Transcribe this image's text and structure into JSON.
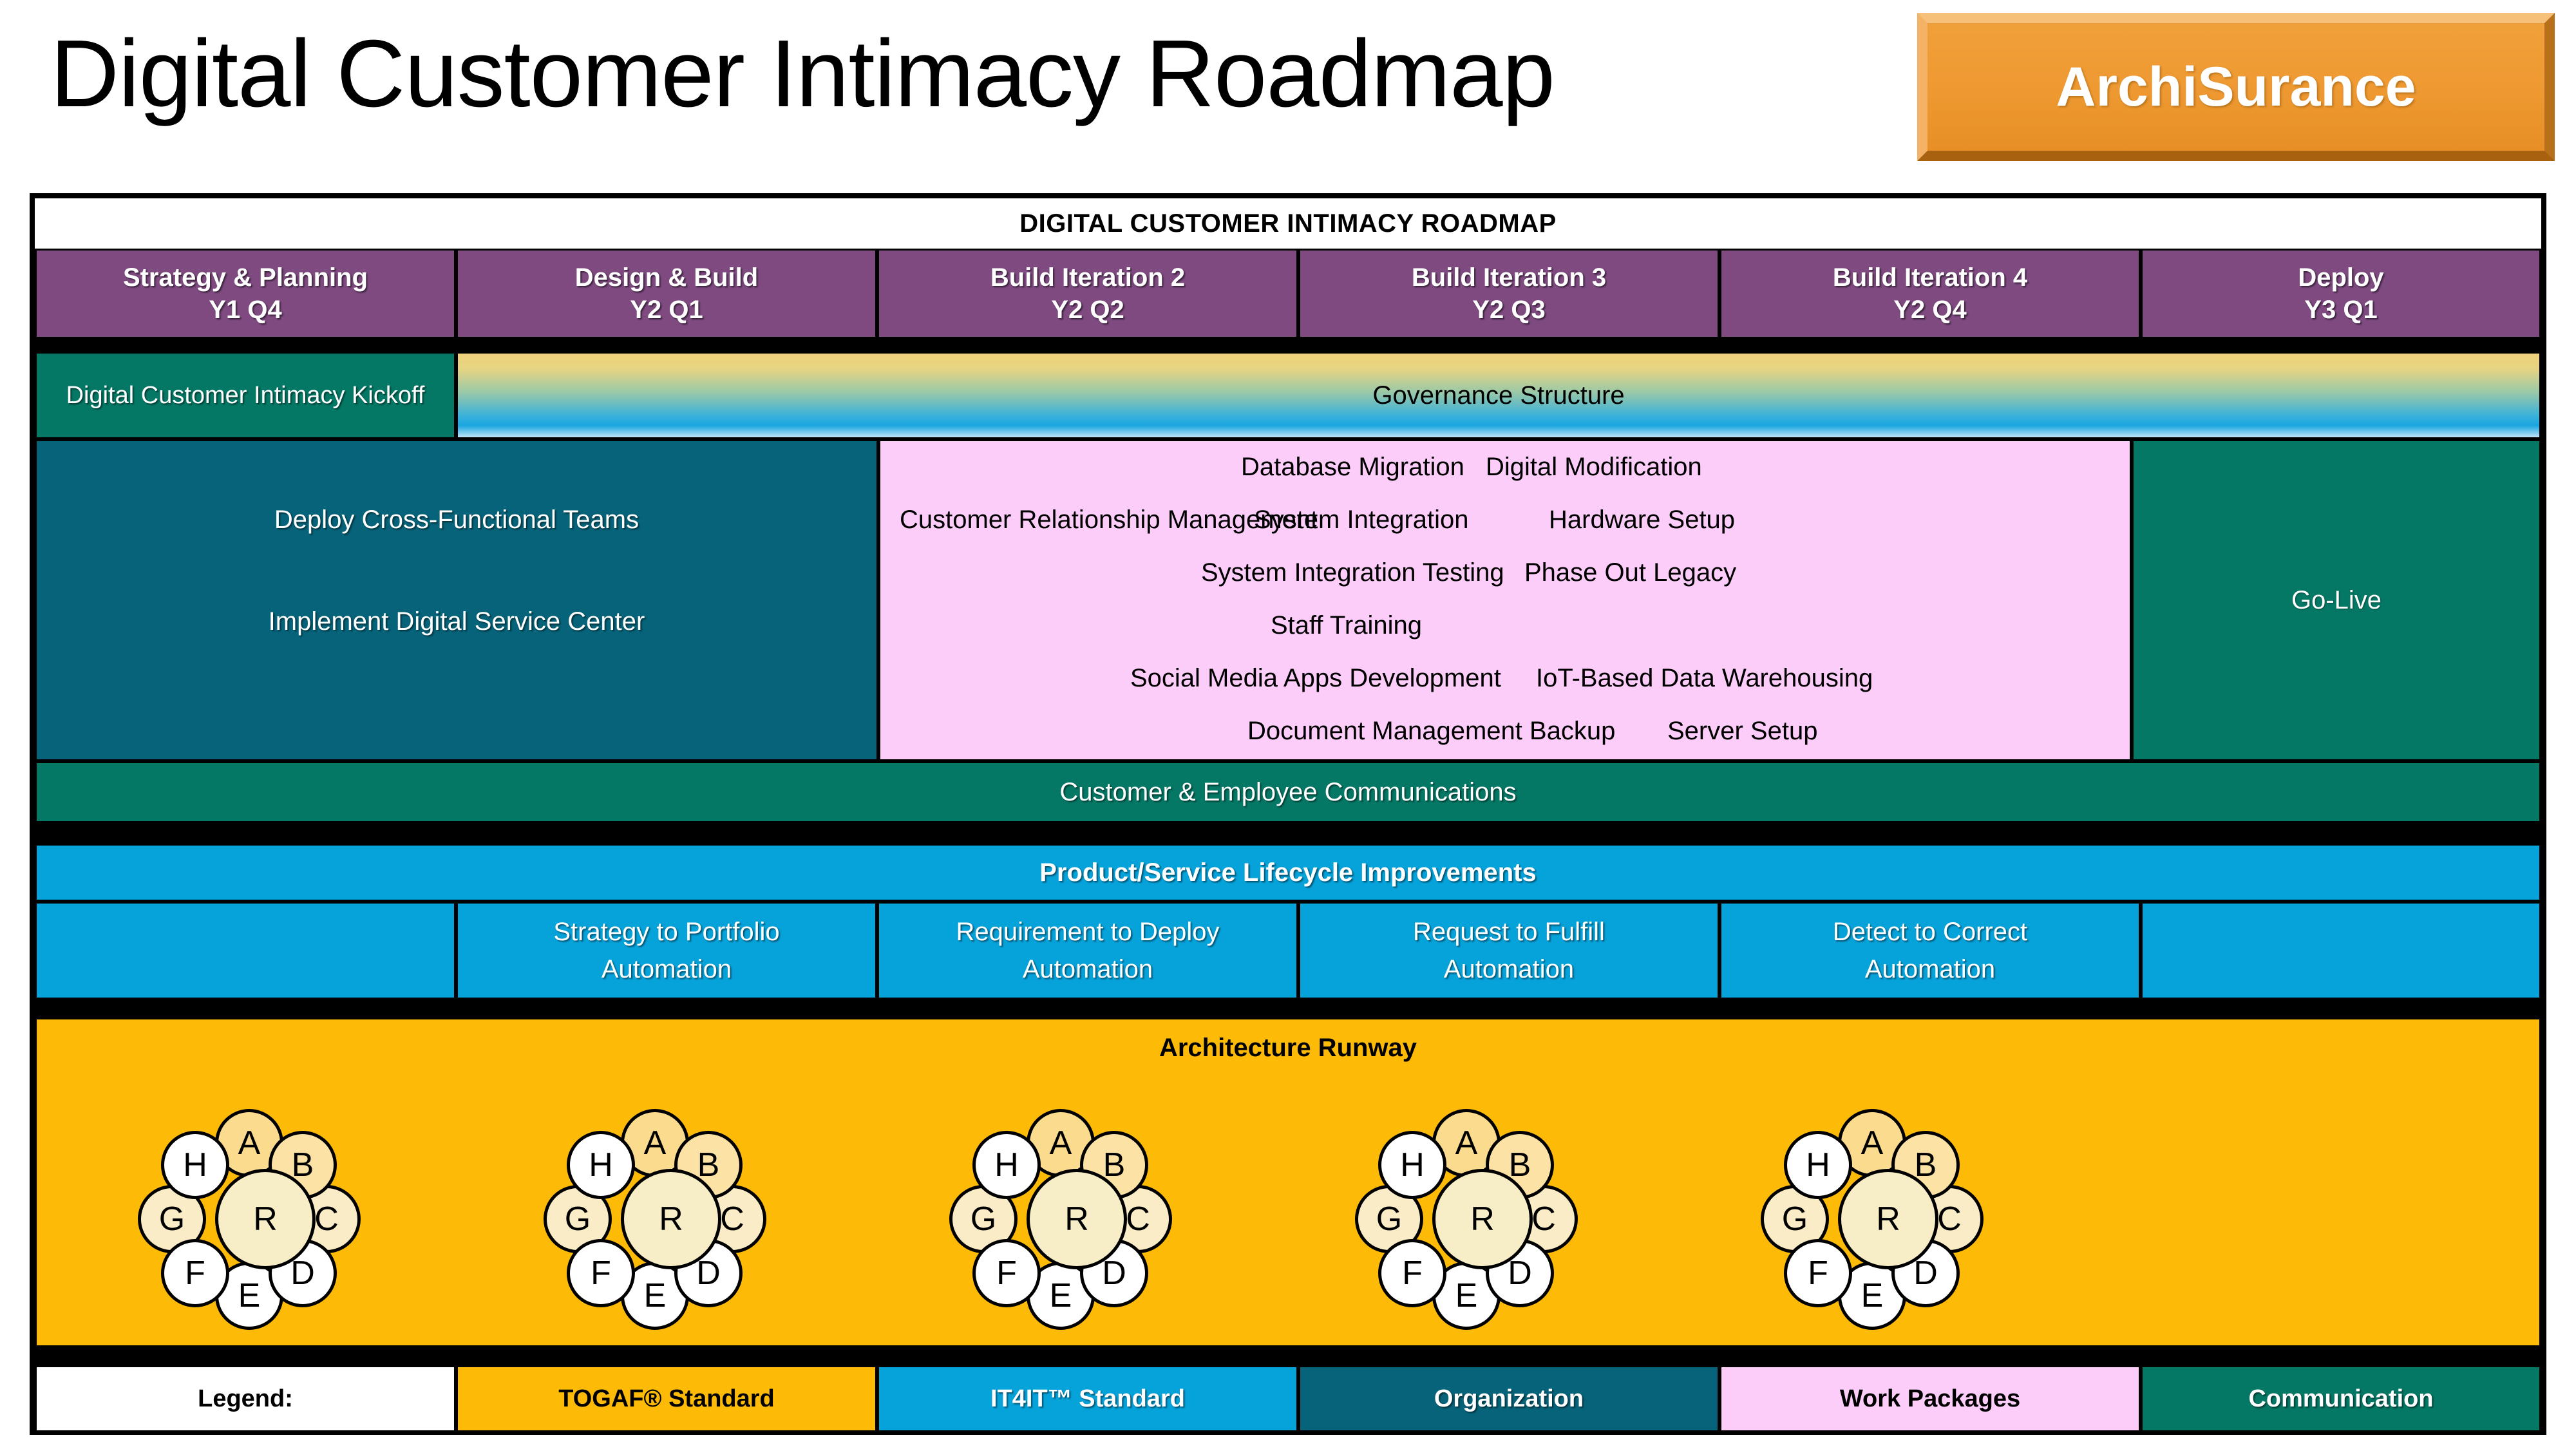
{
  "title": "Digital Customer Intimacy Roadmap",
  "logo": {
    "label": "ArchiSurance"
  },
  "roadmap_caption": "DIGITAL CUSTOMER INTIMACY ROADMAP",
  "phases": [
    {
      "name": "Strategy & Planning",
      "period": "Y1 Q4"
    },
    {
      "name": "Design & Build",
      "period": "Y2 Q1"
    },
    {
      "name": "Build Iteration 2",
      "period": "Y2 Q2"
    },
    {
      "name": "Build Iteration 3",
      "period": "Y2 Q3"
    },
    {
      "name": "Build Iteration 4",
      "period": "Y2 Q4"
    },
    {
      "name": "Deploy",
      "period": "Y3 Q1"
    }
  ],
  "kickoff": {
    "label": "Digital Customer Intimacy Kickoff"
  },
  "governance": {
    "label": "Governance Structure"
  },
  "organization": {
    "items": [
      "Deploy Cross-Functional Teams",
      "Implement Digital Service Center"
    ]
  },
  "work_packages": {
    "items": [
      "Database Migration",
      "Digital Modification",
      "Customer Relationship Management",
      "System Integration",
      "Hardware Setup",
      "System Integration Testing",
      "Phase Out Legacy",
      "Staff Training",
      "Social Media Apps Development",
      "IoT-Based Data Warehousing",
      "Document Management Backup",
      "Server Setup"
    ]
  },
  "go_live": {
    "label": "Go-Live"
  },
  "communications": {
    "label": "Customer & Employee Communications"
  },
  "it4it": {
    "header": "Product/Service Lifecycle Improvements",
    "cells": [
      {
        "line1": "",
        "line2": ""
      },
      {
        "line1": "Strategy to Portfolio",
        "line2": "Automation"
      },
      {
        "line1": "Requirement to Deploy",
        "line2": "Automation"
      },
      {
        "line1": "Request to Fulfill",
        "line2": "Automation"
      },
      {
        "line1": "Detect to Correct",
        "line2": "Automation"
      },
      {
        "line1": "",
        "line2": ""
      }
    ]
  },
  "runway": {
    "title": "Architecture Runway",
    "adm_nodes": [
      "A",
      "B",
      "C",
      "D",
      "E",
      "F",
      "G",
      "H",
      "R"
    ],
    "cycle_count": 5
  },
  "legend": {
    "items": [
      {
        "label": "Legend:",
        "color": "#ffffff",
        "text_color": "#000000"
      },
      {
        "label": "TOGAF® Standard",
        "color": "#fdbb08",
        "text_color": "#000000"
      },
      {
        "label": "IT4IT™ Standard",
        "color": "#06a2da",
        "text_color": "#ffffff"
      },
      {
        "label": "Organization",
        "color": "#066379",
        "text_color": "#ffffff"
      },
      {
        "label": "Work Packages",
        "color": "#fbcdf8",
        "text_color": "#000000"
      },
      {
        "label": "Communication",
        "color": "#057865",
        "text_color": "#ffffff"
      }
    ]
  },
  "colors": {
    "phase_purple": "#7e4a80",
    "organization_teal": "#066379",
    "communication_green": "#057865",
    "it4it_blue": "#06a2da",
    "togaf_yellow": "#fdbb08",
    "work_package_pink": "#fbcdf8",
    "logo_orange": "#ef9a33"
  }
}
